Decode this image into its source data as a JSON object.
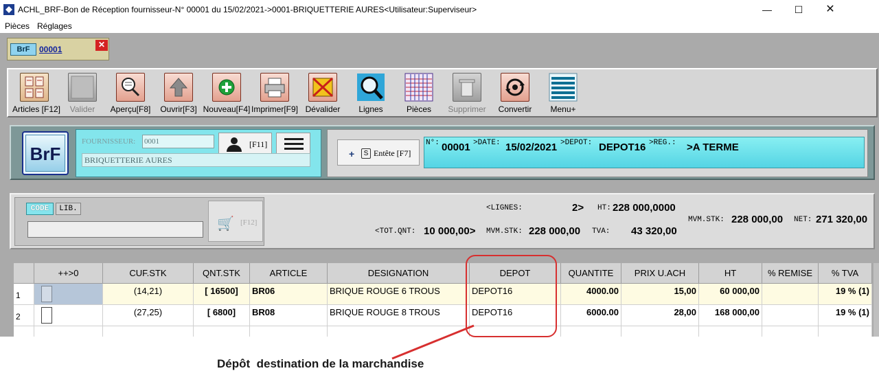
{
  "window": {
    "title": "ACHL_BRF-Bon de Réception fournisseur-N° 00001 du 15/02/2021->0001-BRIQUETTERIE AURES<Utilisateur:Superviseur>",
    "minimize": "—",
    "maximize": "☐",
    "close": "✕"
  },
  "menu": [
    "Pièces",
    "Réglages"
  ],
  "doc_tab": {
    "badge": "BrF",
    "number": "00001",
    "close": "✕"
  },
  "toolbar": [
    {
      "label": "Articles [F12]",
      "icon": "articles-icon",
      "enabled": true
    },
    {
      "label": "Valider",
      "icon": "validate-icon",
      "enabled": false
    },
    {
      "label": "Aperçu[F8]",
      "icon": "preview-icon",
      "enabled": true
    },
    {
      "label": "Ouvrir[F3]",
      "icon": "open-icon",
      "enabled": true
    },
    {
      "label": "Nouveau[F4]",
      "icon": "new-icon",
      "enabled": true
    },
    {
      "label": "Imprimer[F9]",
      "icon": "print-icon",
      "enabled": true
    },
    {
      "label": "Dévalider",
      "icon": "unvalidate-icon",
      "enabled": true
    },
    {
      "label": "Lignes",
      "icon": "lines-icon",
      "enabled": true
    },
    {
      "label": "Pièces",
      "icon": "pieces-icon",
      "enabled": true
    },
    {
      "label": "Supprimer",
      "icon": "delete-icon",
      "enabled": false
    },
    {
      "label": "Convertir",
      "icon": "convert-icon",
      "enabled": true
    },
    {
      "label": "Menu+",
      "icon": "menu-icon",
      "enabled": true
    }
  ],
  "header": {
    "logo": "BrF",
    "supplier_label": "FOURNISSEUR:",
    "supplier_code": "0001",
    "supplier_name": "BRIQUETTERIE AURES",
    "supplier_key": "[F11]",
    "entete_label": "Entête [F7]",
    "entete_s": "S",
    "entete_plus": "+",
    "info": {
      "num_label": "N°:",
      "num": "00001",
      "date_label": ">DATE:",
      "date": "15/02/2021",
      "depot_label": ">DEPOT:",
      "depot": "DEPOT16",
      "reg_label": ">REG.:",
      "reg": ">A TERME"
    }
  },
  "totals": {
    "code_radio": "CODE",
    "lib_radio": "LIB.",
    "cart_key": "[F12]",
    "lignes_label": "<LIGNES:",
    "lignes": "2>",
    "ht_label": "HT:",
    "ht": "228 000,0000",
    "tot_qnt_label": "<TOT.QNT:",
    "tot_qnt": "10 000,00>",
    "mvm_stk_label": "MVM.STK:",
    "mvm_stk": "228 000,00",
    "tva_label": "TVA:",
    "tva": "43 320,00",
    "mvm_stk2_label": "MVM.STK:",
    "mvm_stk2": "228 000,00",
    "net_label": "NET:",
    "net": "271 320,00"
  },
  "grid": {
    "columns": [
      "",
      "++>0",
      "CUF.STK",
      "QNT.STK",
      "ARTICLE",
      "DESIGNATION",
      "DEPOT",
      "QUANTITE",
      "PRIX U.ACH",
      "HT",
      "% REMISE",
      "% TVA"
    ],
    "rows": [
      {
        "num": "1",
        "cuf": "(14,21)",
        "qnt_stk": "[ 16500]",
        "article": "BR06",
        "designation": "BRIQUE ROUGE 6 TROUS",
        "depot": "DEPOT16",
        "quantite": "4000.00",
        "prix": "15,00",
        "ht": "60 000,00",
        "remise": "",
        "tva": "19 % (1)"
      },
      {
        "num": "2",
        "cuf": "(27,25)",
        "qnt_stk": "[ 6800]",
        "article": "BR08",
        "designation": "BRIQUE ROUGE 8 TROUS",
        "depot": "DEPOT16",
        "quantite": "6000.00",
        "prix": "28,00",
        "ht": "168 000,00",
        "remise": "",
        "tva": "19 % (1)"
      }
    ]
  },
  "annotation": {
    "text": "Dépôt  destination de la marchandise",
    "color": "#d72f2f"
  }
}
